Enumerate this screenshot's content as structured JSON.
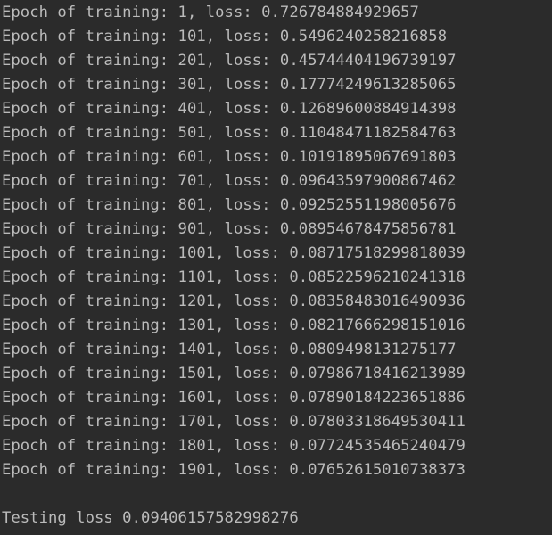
{
  "console": {
    "lines": [
      "Epoch of training: 1, loss: 0.726784884929657",
      "Epoch of training: 101, loss: 0.5496240258216858",
      "Epoch of training: 201, loss: 0.45744404196739197",
      "Epoch of training: 301, loss: 0.17774249613285065",
      "Epoch of training: 401, loss: 0.12689600884914398",
      "Epoch of training: 501, loss: 0.11048471182584763",
      "Epoch of training: 601, loss: 0.10191895067691803",
      "Epoch of training: 701, loss: 0.09643597900867462",
      "Epoch of training: 801, loss: 0.09252551198005676",
      "Epoch of training: 901, loss: 0.08954678475856781",
      "Epoch of training: 1001, loss: 0.08717518299818039",
      "Epoch of training: 1101, loss: 0.08522596210241318",
      "Epoch of training: 1201, loss: 0.08358483016490936",
      "Epoch of training: 1301, loss: 0.08217666298151016",
      "Epoch of training: 1401, loss: 0.0809498131275177",
      "Epoch of training: 1501, loss: 0.07986718416213989",
      "Epoch of training: 1601, loss: 0.07890184223651886",
      "Epoch of training: 1701, loss: 0.07803318649530411",
      "Epoch of training: 1801, loss: 0.07724535465240479",
      "Epoch of training: 1901, loss: 0.07652615010738373"
    ],
    "testing_line": "Testing loss 0.09406157582998276"
  },
  "colors": {
    "background": "#2b2b2b",
    "text": "#bbbbbb"
  }
}
